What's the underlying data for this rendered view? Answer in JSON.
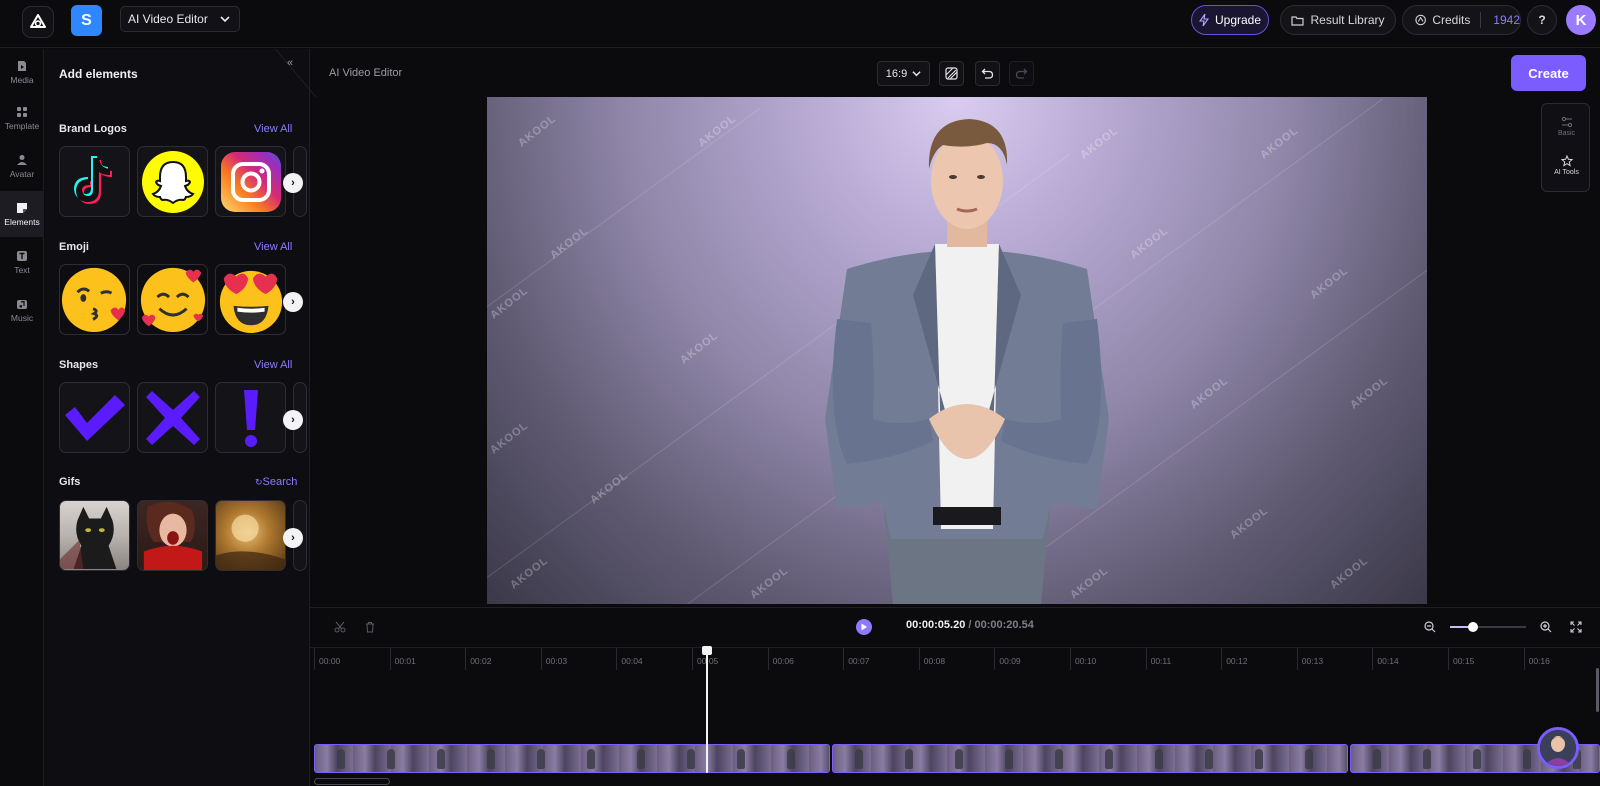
{
  "header": {
    "project_name": "AI Video Editor",
    "s_badge": "S",
    "upgrade_label": "Upgrade",
    "result_library_label": "Result Library",
    "credits_label": "Credits",
    "credits_value": "1942",
    "help_label": "?",
    "avatar_initial": "K"
  },
  "rail": {
    "items": [
      {
        "label": "Media",
        "icon": "media-icon"
      },
      {
        "label": "Template",
        "icon": "template-icon"
      },
      {
        "label": "Avatar",
        "icon": "avatar-icon"
      },
      {
        "label": "Elements",
        "icon": "elements-icon",
        "active": true
      },
      {
        "label": "Text",
        "icon": "text-icon"
      },
      {
        "label": "Music",
        "icon": "music-icon"
      }
    ]
  },
  "panel": {
    "title": "Add elements",
    "collapse_icon": "double-chevron-left-icon",
    "sections": [
      {
        "title": "Brand Logos",
        "action": "View All",
        "items": [
          "tiktok-logo",
          "snapchat-logo",
          "instagram-logo"
        ]
      },
      {
        "title": "Emoji",
        "action": "View All",
        "items": [
          "kissing-face-emoji",
          "smiling-face-with-hearts-emoji",
          "heart-eyes-emoji"
        ]
      },
      {
        "title": "Shapes",
        "action": "View All",
        "items": [
          "check-mark-shape",
          "cross-shape",
          "exclamation-shape"
        ]
      },
      {
        "title": "Gifs",
        "action": "Search",
        "items": [
          "black-cat-gif",
          "screaming-woman-gif",
          "golden-scene-gif"
        ]
      }
    ]
  },
  "editor": {
    "title": "AI Video Editor",
    "aspect_ratio": "16:9",
    "create_label": "Create",
    "watermark": "AKOOL"
  },
  "tools": {
    "basic_label": "Basic",
    "ai_tools_label": "AI Tools"
  },
  "player": {
    "current_time": "00:00:05.20",
    "separator": " / ",
    "total_time": "00:00:20.54",
    "zoom_level": 0.3
  },
  "timeline": {
    "ticks": [
      "00:00",
      "00:01",
      "00:02",
      "00:03",
      "00:04",
      "00:05",
      "00:06",
      "00:07",
      "00:08",
      "00:09",
      "00:10",
      "00:11",
      "00:12",
      "00:13",
      "00:14",
      "00:15",
      "00:16"
    ]
  },
  "colors": {
    "accent": "#7b5cff",
    "background": "#0b0b0e",
    "credits": "#8b7bff"
  }
}
